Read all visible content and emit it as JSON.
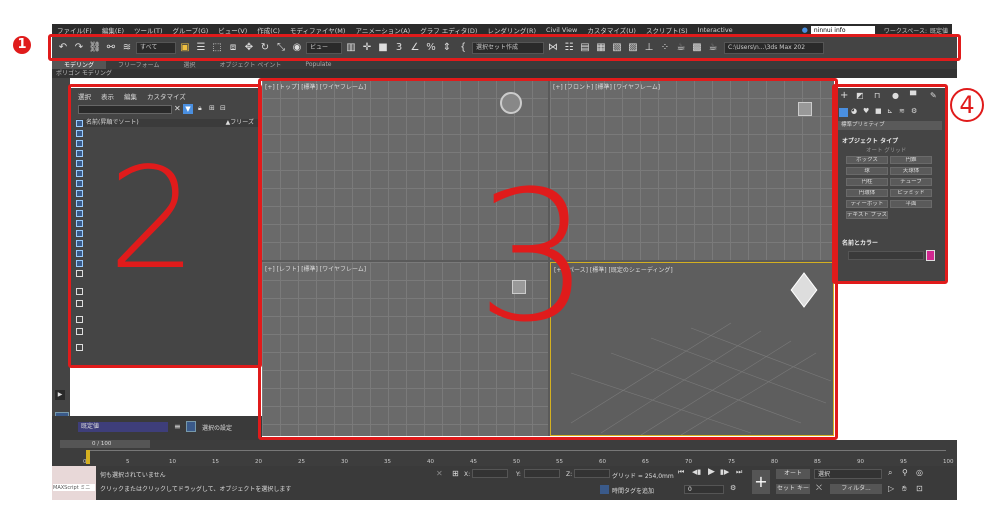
{
  "annotations": {
    "one": "1",
    "two": "2",
    "three": "3",
    "four": "4"
  },
  "menu": [
    "ファイル(F)",
    "編集(E)",
    "ツール(T)",
    "グループ(G)",
    "ビュー(V)",
    "作成(C)",
    "モディファイヤ(M)",
    "アニメーション(A)",
    "グラフ エディタ(D)",
    "レンダリング(R)",
    "Civil View",
    "カスタマイズ(U)",
    "スクリプト(S)",
    "Interactive"
  ],
  "user": {
    "name": "ninnui info",
    "workspace_label": "ワークスペース:",
    "workspace": "既定値"
  },
  "toolbar": {
    "filter": "すべて",
    "view": "ビュー",
    "selection_set": "選択セット作成",
    "path": "C:\\Users\\n...\\3ds Max 202"
  },
  "ribbon": {
    "tabs": [
      "モデリング",
      "フリーフォーム",
      "選択",
      "オブジェクト ペイント",
      "Populate"
    ],
    "sub": "ポリゴン モデリング"
  },
  "explorer": {
    "tabs": [
      "選択",
      "表示",
      "編集",
      "カスタマイズ"
    ],
    "col_name": "名前(昇順でソート)",
    "col_freeze": "▲フリーズ"
  },
  "viewports": {
    "top": "[+] [トップ] [標準] [ワイヤフレーム]",
    "front": "[+] [フロント] [標準] [ワイヤフレーム]",
    "left": "[+] [レフト] [標準] [ワイヤフレーム]",
    "persp": "[+] [パース] [標準] [既定のシェーディング]"
  },
  "command": {
    "category": "標準プリミティブ",
    "rollout1": "オブジェクト タイプ",
    "autogrid": "オート グリッド",
    "buttons": [
      "ボックス",
      "円錐",
      "球",
      "天球体",
      "円柱",
      "チューブ",
      "円環体",
      "ピラミッド",
      "ティーポット",
      "平面",
      "テキスト プラス"
    ],
    "rollout2": "名前とカラー"
  },
  "bottom": {
    "layer": "既定値",
    "selset": "選択の設定"
  },
  "timeline": {
    "frame": "0 / 100",
    "ticks": [
      "0",
      "5",
      "10",
      "15",
      "20",
      "25",
      "30",
      "35",
      "40",
      "45",
      "50",
      "55",
      "60",
      "65",
      "70",
      "75",
      "80",
      "85",
      "90",
      "95",
      "100"
    ]
  },
  "status": {
    "script": "MAXScript ミニ",
    "line1": "何も選択されていません",
    "line2": "クリックまたはクリックしてドラッグして、オブジェクトを選択します",
    "x": "X:",
    "y": "Y:",
    "z": "Z:",
    "grid": "グリッド = 254,0mm",
    "addtime": "時間タグを追加",
    "auto": "オート",
    "setkey": "セット キー",
    "selected": "選択",
    "filter": "フィルタ...",
    "frame": "0"
  }
}
